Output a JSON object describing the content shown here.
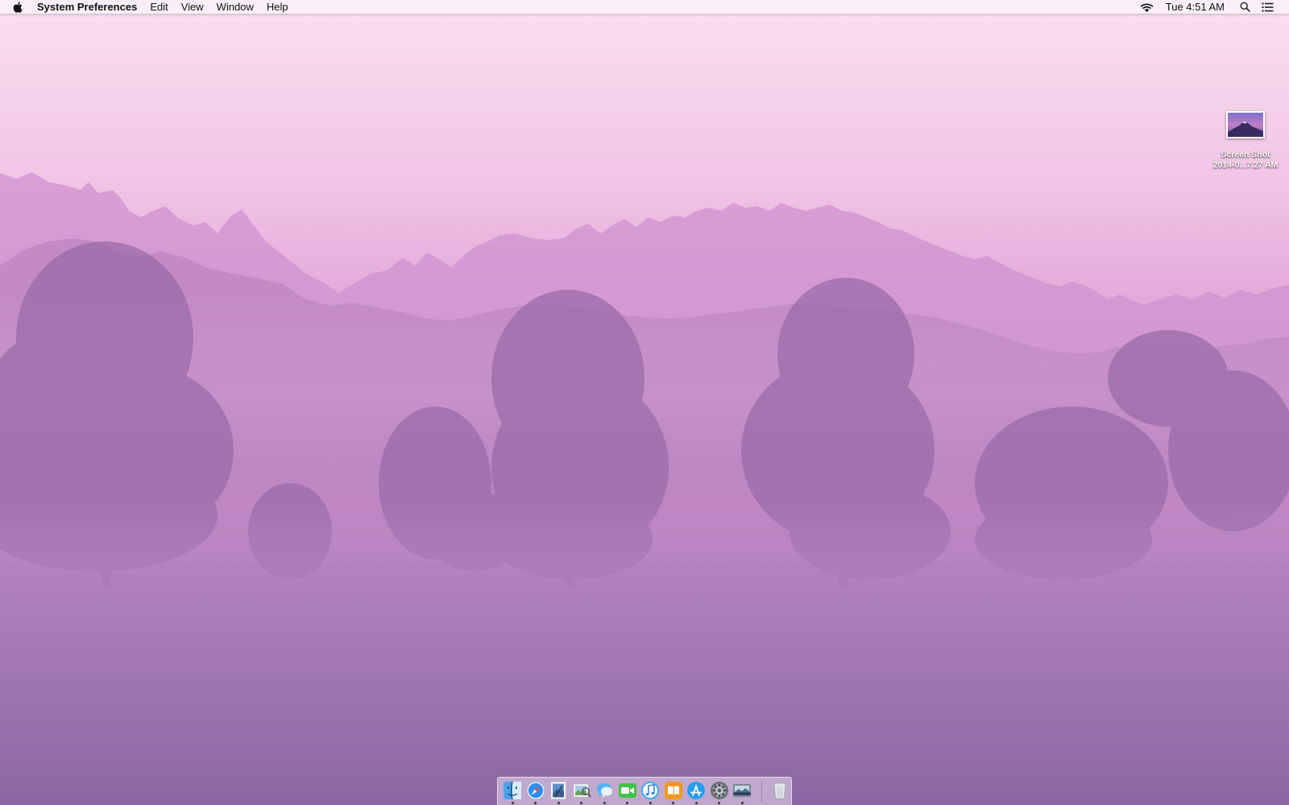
{
  "menubar": {
    "apple_icon": "apple-logo-icon",
    "app_name": "System Preferences",
    "menus": [
      "Edit",
      "View",
      "Window",
      "Help"
    ],
    "wifi_icon": "wifi-icon",
    "clock": "Tue 4:51 AM",
    "spotlight_icon": "spotlight-search-icon",
    "notification_center_icon": "notification-center-icon"
  },
  "desktop": {
    "wallpaper": "misty purple forest",
    "icons": [
      {
        "icon": "image-file-icon",
        "label_line1": "Screen Shot",
        "label_line2": "2014-0...7.27 AM"
      }
    ]
  },
  "dock": {
    "apps": [
      {
        "name": "finder",
        "icon": "finder-icon",
        "running": true
      },
      {
        "name": "safari",
        "icon": "safari-icon",
        "running": true
      },
      {
        "name": "mail",
        "icon": "mail-stamp-icon",
        "running": true
      },
      {
        "name": "preview",
        "icon": "preview-icon",
        "running": true
      },
      {
        "name": "messages",
        "icon": "messages-icon",
        "running": true
      },
      {
        "name": "facetime",
        "icon": "facetime-icon",
        "running": true
      },
      {
        "name": "itunes",
        "icon": "itunes-icon",
        "running": true
      },
      {
        "name": "ibooks",
        "icon": "ibooks-icon",
        "running": true
      },
      {
        "name": "app-store",
        "icon": "app-store-icon",
        "running": true
      },
      {
        "name": "system-preferences",
        "icon": "system-preferences-gear-icon",
        "running": true
      },
      {
        "name": "photo-browser",
        "icon": "photo-browser-icon",
        "running": true
      }
    ],
    "trash": {
      "name": "trash",
      "icon": "trash-icon",
      "running": false
    }
  },
  "colors": {
    "sky_top": "#f7dcef",
    "fog_mid": "#c58fcc",
    "ground": "#8f6aa8",
    "tree_far": "#c48bc7",
    "tree_mid": "#a978b5",
    "tree_near": "#8e6199"
  }
}
